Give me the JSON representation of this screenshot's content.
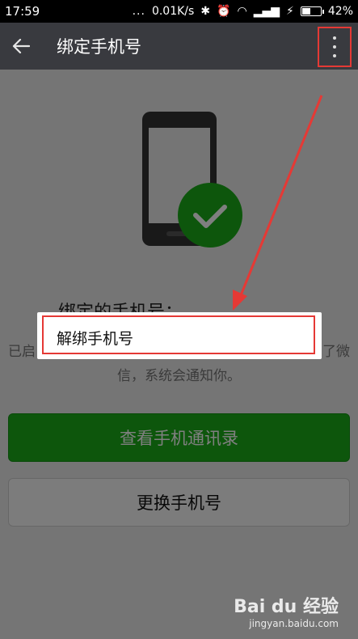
{
  "status_bar": {
    "time": "17:59",
    "dots": "...",
    "speed": "0.01K/s",
    "battery_pct": "42%",
    "battery_level": 0.42
  },
  "app_bar": {
    "title": "绑定手机号",
    "back_icon": "arrow-left-icon",
    "more_icon": "more-vertical-icon"
  },
  "content": {
    "bound_label": "绑定的手机号：",
    "desc_line1": "已启",
    "desc_line1_end": "了微",
    "desc_line2": "信，系统会通知你。",
    "view_contacts_button": "查看手机通讯录",
    "change_phone_button": "更换手机号"
  },
  "popup_menu": {
    "items": [
      {
        "label": "解绑手机号"
      }
    ]
  },
  "colors": {
    "app_bar": "#393a3f",
    "primary_green": "#1aad19",
    "annotation_red": "#e53935",
    "check_circle": "#1aad19"
  },
  "watermark": {
    "logo": "Bai du 经验",
    "url": "jingyan.baidu.com"
  }
}
